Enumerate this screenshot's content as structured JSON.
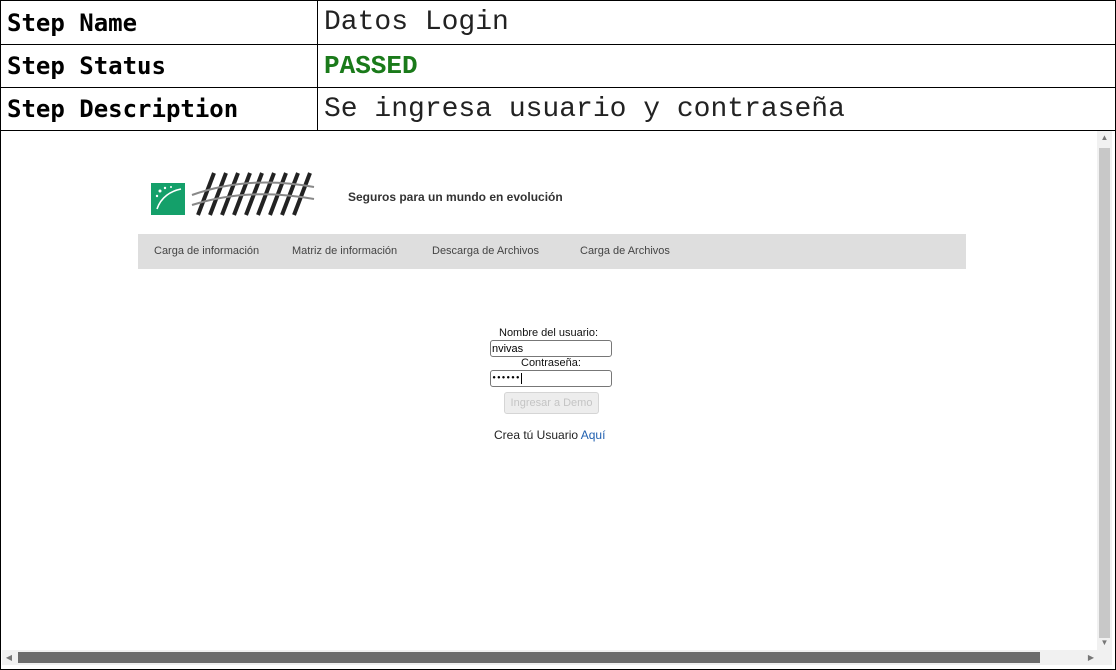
{
  "report": {
    "rows": [
      {
        "label": "Step Name",
        "value": "Datos Login"
      },
      {
        "label": "Step Status",
        "value": "PASSED"
      },
      {
        "label": "Step Description",
        "value": "Se ingresa usuario y contraseña"
      }
    ],
    "status_color": "#1a7a1a"
  },
  "app": {
    "tagline": "Seguros para un mundo en evolución",
    "brand_color": "#14a06a",
    "nav": [
      {
        "label": "Carga de información"
      },
      {
        "label": "Matriz de información"
      },
      {
        "label": "Descarga de Archivos"
      },
      {
        "label": "Carga de Archivos"
      }
    ],
    "login": {
      "username_label": "Nombre del usuario:",
      "username_value": "nvivas",
      "password_label": "Contraseña:",
      "password_value": "••••••",
      "submit_label": "Ingresar a Demo",
      "create_text": "Crea tú Usuario ",
      "create_link": "Aquí"
    }
  }
}
